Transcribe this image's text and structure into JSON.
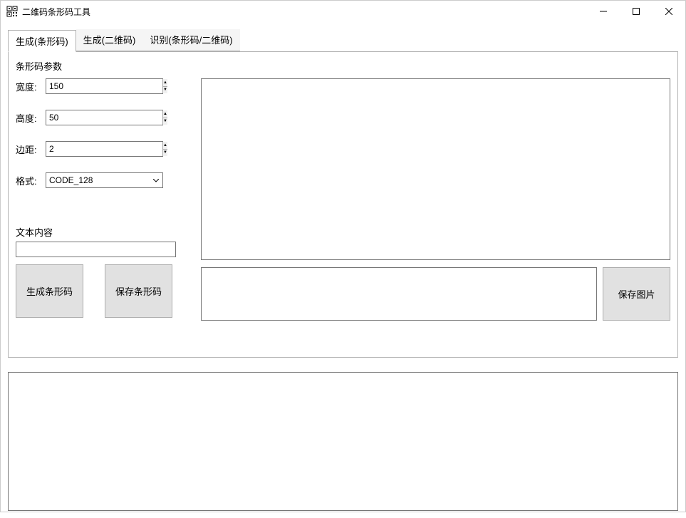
{
  "window": {
    "title": "二维码条形码工具"
  },
  "tabs": {
    "tab1": "生成(条形码)",
    "tab2": "生成(二维码)",
    "tab3": "识别(条形码/二维码)"
  },
  "groupbox": {
    "title": "条形码参数"
  },
  "fields": {
    "width": {
      "label": "宽度:",
      "value": "150"
    },
    "height": {
      "label": "高度:",
      "value": "50"
    },
    "margin": {
      "label": "边距:",
      "value": "2"
    },
    "format": {
      "label": "格式:",
      "value": "CODE_128"
    }
  },
  "textContent": {
    "label": "文本内容",
    "value": ""
  },
  "buttons": {
    "generateBarcode": "生成条形码",
    "saveBarcode": "保存条形码",
    "saveImage": "保存图片"
  },
  "log": {
    "value": ""
  }
}
